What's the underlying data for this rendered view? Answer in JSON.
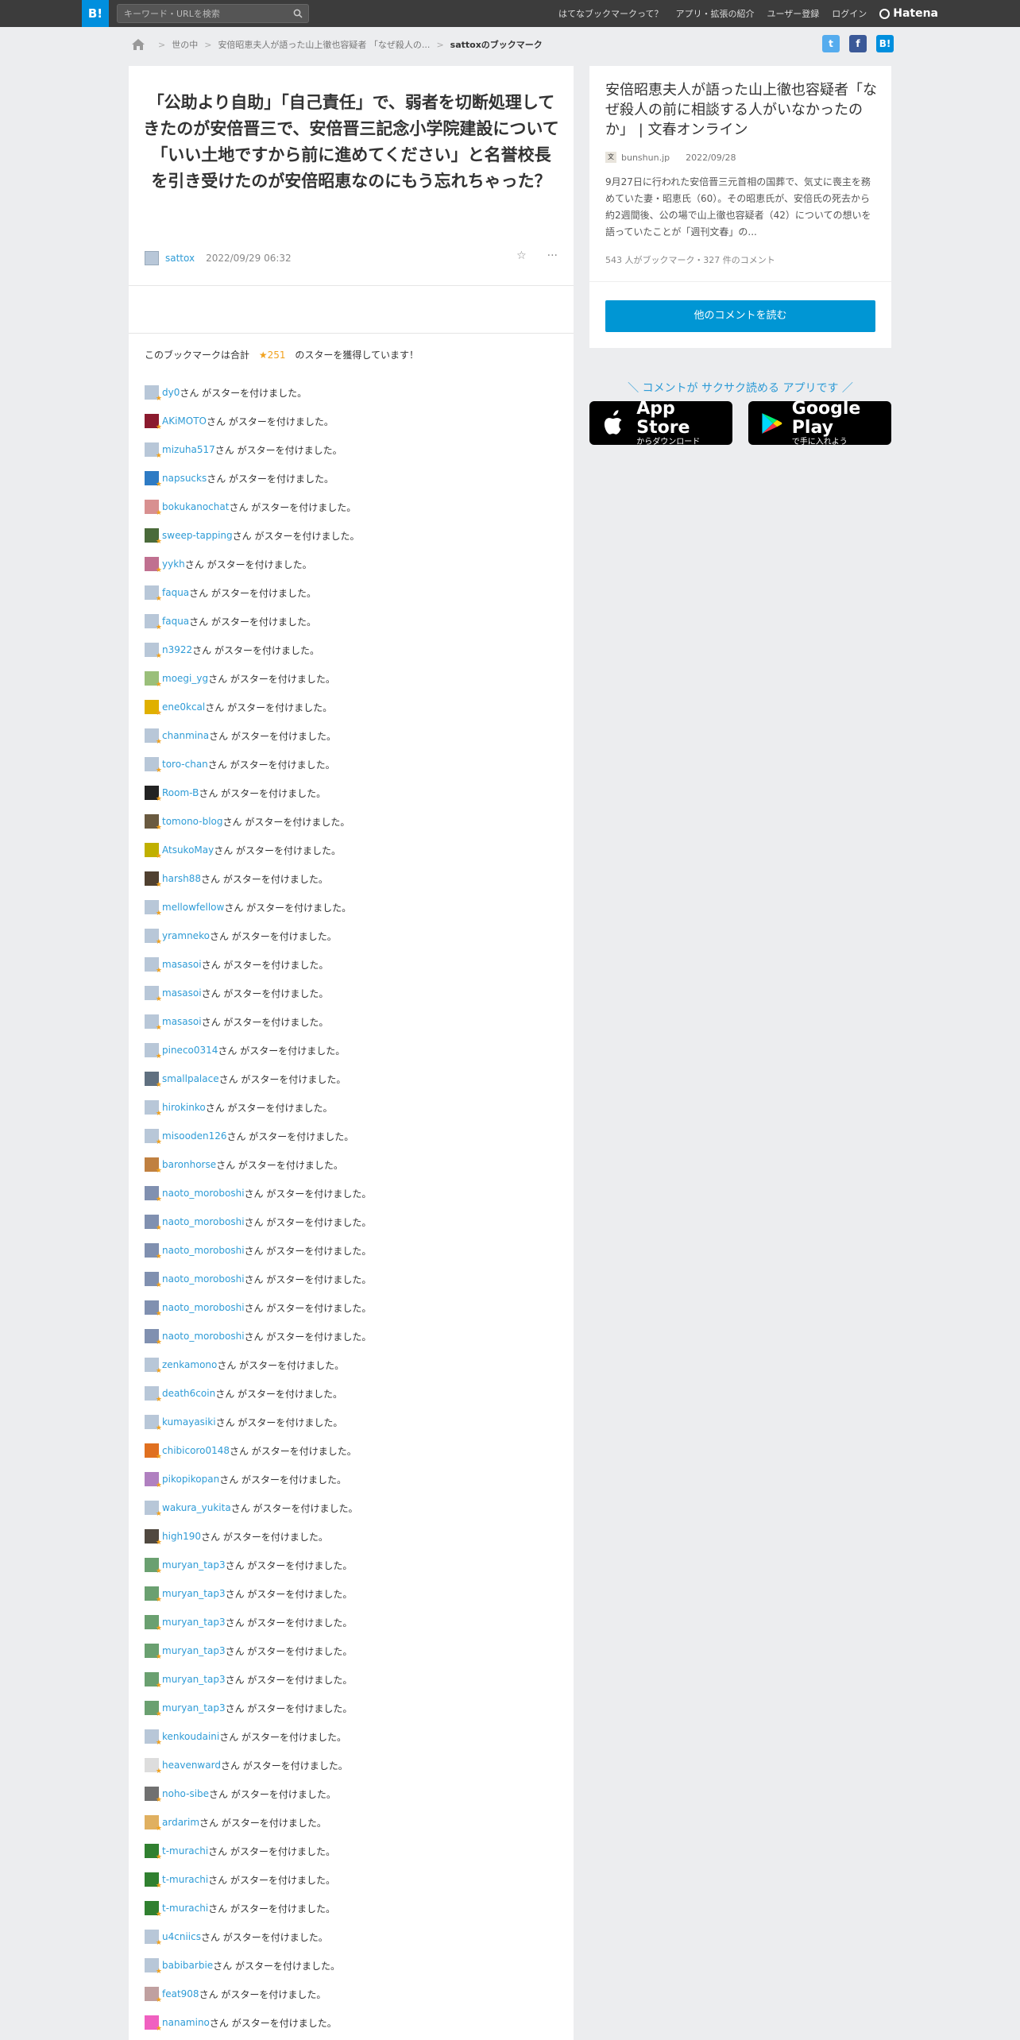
{
  "header": {
    "logo": "B!",
    "search_placeholder": "キーワード・URLを検索",
    "nav": [
      "はてなブックマークって？",
      "アプリ・拡張の紹介",
      "ユーザー登録",
      "ログイン"
    ],
    "brand": "Hatena"
  },
  "breadcrumb": {
    "items": [
      "世の中",
      "安倍昭恵夫人が語った山上徹也容疑者 「なぜ殺人の..."
    ],
    "current": "sattoxのブックマーク"
  },
  "bookmark": {
    "comment": "「公助より自助」「自己責任」で、弱者を切断処理してきたのが安倍晋三で、安倍晋三記念小学院建設について「いい土地ですから前に進めてください」と名誉校長を引き受けたのが安倍昭恵なのにもう忘れちゃった？",
    "user": "sattox",
    "date": "2022/09/29 06:32",
    "star_summary_prefix": "このブックマークは合計",
    "star_count": "★251",
    "star_summary_suffix": "のスターを獲得しています！"
  },
  "star_suffix": "さん がスターを付けました。",
  "star_users": [
    "dy0",
    "AKiMOTO",
    "mizuha517",
    "napsucks",
    "bokukanochat",
    "sweep-tapping",
    "yykh",
    "faqua",
    "faqua",
    "n3922",
    "moegi_yg",
    "ene0kcal",
    "chanmina",
    "toro-chan",
    "Room-B",
    "tomono-blog",
    "AtsukoMay",
    "harsh88",
    "mellowfellow",
    "yramneko",
    "masasoi",
    "masasoi",
    "masasoi",
    "pineco0314",
    "smallpalace",
    "hirokinko",
    "misooden126",
    "baronhorse",
    "naoto_moroboshi",
    "naoto_moroboshi",
    "naoto_moroboshi",
    "naoto_moroboshi",
    "naoto_moroboshi",
    "naoto_moroboshi",
    "zenkamono",
    "death6coin",
    "kumayasiki",
    "chibicoro0148",
    "pikopikopan",
    "wakura_yukita",
    "high190",
    "muryan_tap3",
    "muryan_tap3",
    "muryan_tap3",
    "muryan_tap3",
    "muryan_tap3",
    "muryan_tap3",
    "kenkoudaini",
    "heavenward",
    "noho-sibe",
    "ardarim",
    "t-murachi",
    "t-murachi",
    "t-murachi",
    "u4cniics",
    "babibarbie",
    "feat908",
    "nanamino"
  ],
  "avatar_colors": [
    "#b8c7d8",
    "#8b1a2e",
    "#b8c7d8",
    "#2e7bc4",
    "#d89090",
    "#4a6a3a",
    "#c07090",
    "#b8c7d8",
    "#b8c7d8",
    "#b8c7d8",
    "#9abf7a",
    "#e0b000",
    "#b8c7d8",
    "#b8c7d8",
    "#222222",
    "#6a5a40",
    "#c0b000",
    "#504030",
    "#b8c7d8",
    "#b8c7d8",
    "#b8c7d8",
    "#b8c7d8",
    "#b8c7d8",
    "#b8c7d8",
    "#607080",
    "#b8c7d8",
    "#b8c7d8",
    "#c08040",
    "#8090b0",
    "#8090b0",
    "#8090b0",
    "#8090b0",
    "#8090b0",
    "#8090b0",
    "#b8c7d8",
    "#b8c7d8",
    "#b8c7d8",
    "#e07020",
    "#b080c0",
    "#b8c7d8",
    "#504840",
    "#6aa070",
    "#6aa070",
    "#6aa070",
    "#6aa070",
    "#6aa070",
    "#6aa070",
    "#b8c7d8",
    "#dddddd",
    "#707070",
    "#e0b060",
    "#308030",
    "#308030",
    "#308030",
    "#b8c7d8",
    "#b8c7d8",
    "#c0a0a0",
    "#f060c0"
  ],
  "entry": {
    "title": "安倍昭恵夫人が語った山上徹也容疑者「なぜ殺人の前に相談する人がいなかったのか」 | 文春オンライン",
    "source": "bunshun.jp",
    "source_icon": "文",
    "date": "2022/09/28",
    "summary": "9月27日に行われた安倍晋三元首相の国葬で、気丈に喪主を務めていた妻・昭恵氏（60）。その昭恵氏が、安倍氏の死去から約2週間後、公の場で山上徹也容疑者（42）についての想いを語っていたことが「週刊文春」の...",
    "counts": "543 人がブックマーク・327 件のコメント",
    "more_button": "他のコメントを読む"
  },
  "promo": {
    "text": "＼ コメントが サクサク読める アプリです ／",
    "apple_t1": "App Store",
    "apple_t2": "からダウンロード",
    "google_t1": "Google Play",
    "google_t2": "で手に入れよう"
  },
  "share": {
    "twitter": "t",
    "facebook": "f",
    "hatena": "B!"
  }
}
